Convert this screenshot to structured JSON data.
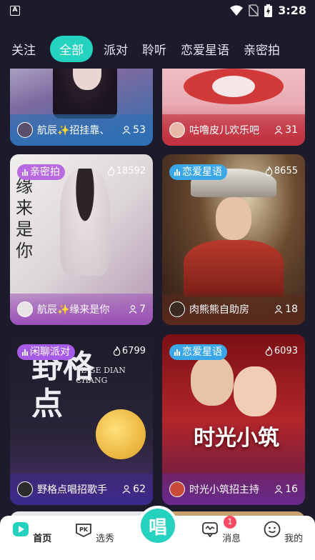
{
  "status": {
    "time": "3:28",
    "notif_icon": "A"
  },
  "tabs": [
    "关注",
    "全部",
    "派对",
    "聆听",
    "恋爱星语",
    "亲密拍"
  ],
  "cards": [
    {
      "badge": "",
      "heat": "",
      "name": "航辰✨招挂靠、",
      "count": "53"
    },
    {
      "badge": "",
      "heat": "",
      "name": "咕噜皮儿欢乐吧",
      "count": "31"
    },
    {
      "badge": "亲密拍",
      "heat": "18592",
      "name": "航辰✨缘来是你",
      "count": "7",
      "art_text": "缘来是你"
    },
    {
      "badge": "恋爱星语",
      "heat": "8655",
      "name": "肉熊熊自助房",
      "count": "18"
    },
    {
      "badge": "闲聊派对",
      "heat": "6799",
      "name": "野格点唱招歌手",
      "count": "62",
      "art_text": "野格点",
      "art_sub": "YE GE DIAN CHANG"
    },
    {
      "badge": "恋爱星语",
      "heat": "6093",
      "name": "时光小筑招主持",
      "count": "16",
      "art_text": "时光小筑"
    }
  ],
  "nav": {
    "home": "首页",
    "pk": "选秀",
    "center": "唱",
    "msg": "消息",
    "msg_badge": "1",
    "me": "我的"
  }
}
